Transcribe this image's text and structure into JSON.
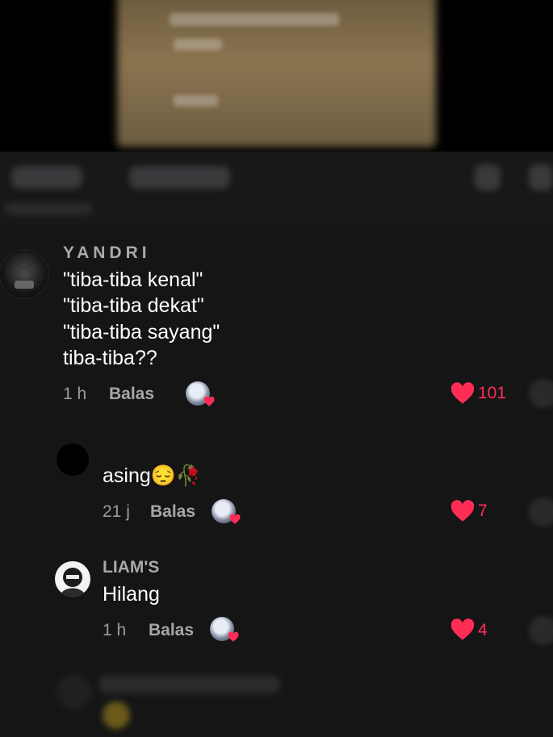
{
  "comments": [
    {
      "username": "YANDRI",
      "lines": [
        "\"tiba-tiba kenal\"",
        "\"tiba-tiba dekat\"",
        "\"tiba-tiba sayang\"",
        "tiba-tiba??"
      ],
      "time": "1 h",
      "reply_label": "Balas",
      "likes": "101"
    }
  ],
  "replies": [
    {
      "username": "",
      "text": "asing😔🥀",
      "time": "21 j",
      "reply_label": "Balas",
      "likes": "7"
    },
    {
      "username": "LIAM'S",
      "text": "Hilang",
      "time": "1 h",
      "reply_label": "Balas",
      "likes": "4"
    }
  ],
  "colors": {
    "background": "#151516",
    "like_red": "#ff2c55",
    "muted_text": "#9c9ca0"
  }
}
